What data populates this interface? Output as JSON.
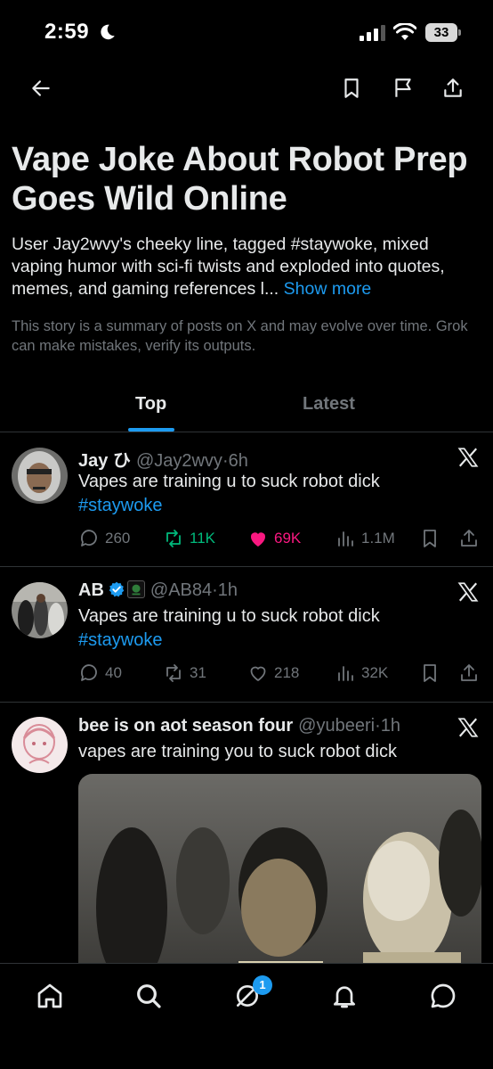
{
  "status_bar": {
    "time": "2:59",
    "battery": "33"
  },
  "story": {
    "title": "Vape Joke About Robot Prep Goes Wild Online",
    "summary": "User Jay2wvy's cheeky line, tagged #staywoke, mixed vaping humor with sci-fi twists and exploded into quotes, memes, and gaming references l...",
    "show_more": "Show more",
    "disclaimer": "This story is a summary of posts on X and may evolve over time. Grok can make mistakes, verify its outputs."
  },
  "tabs": [
    {
      "label": "Top",
      "active": true
    },
    {
      "label": "Latest",
      "active": false
    }
  ],
  "posts": [
    {
      "name": "Jay ひ",
      "handle": "@Jay2wvy",
      "time": "6h",
      "text": "Vapes are training u to suck robot dick",
      "hashtag": "#staywoke",
      "replies": "260",
      "reposts": "11K",
      "likes": "69K",
      "views": "1.1M",
      "reposted": true,
      "liked": true
    },
    {
      "name": "AB",
      "handle": "@AB84",
      "time": "1h",
      "text": "Vapes are training u to suck robot dick",
      "hashtag": "#staywoke",
      "replies": "40",
      "reposts": "31",
      "likes": "218",
      "views": "32K",
      "verified": true
    },
    {
      "name": "bee is on aot season four",
      "handle": "@yubeeri",
      "time": "1h",
      "text": "vapes are training you to suck robot dick"
    }
  ],
  "bottom_nav": {
    "grok_badge": "1"
  },
  "colors": {
    "accent": "#1d9bf0",
    "repost": "#00ba7c",
    "like": "#f91880",
    "muted": "#71767b"
  }
}
